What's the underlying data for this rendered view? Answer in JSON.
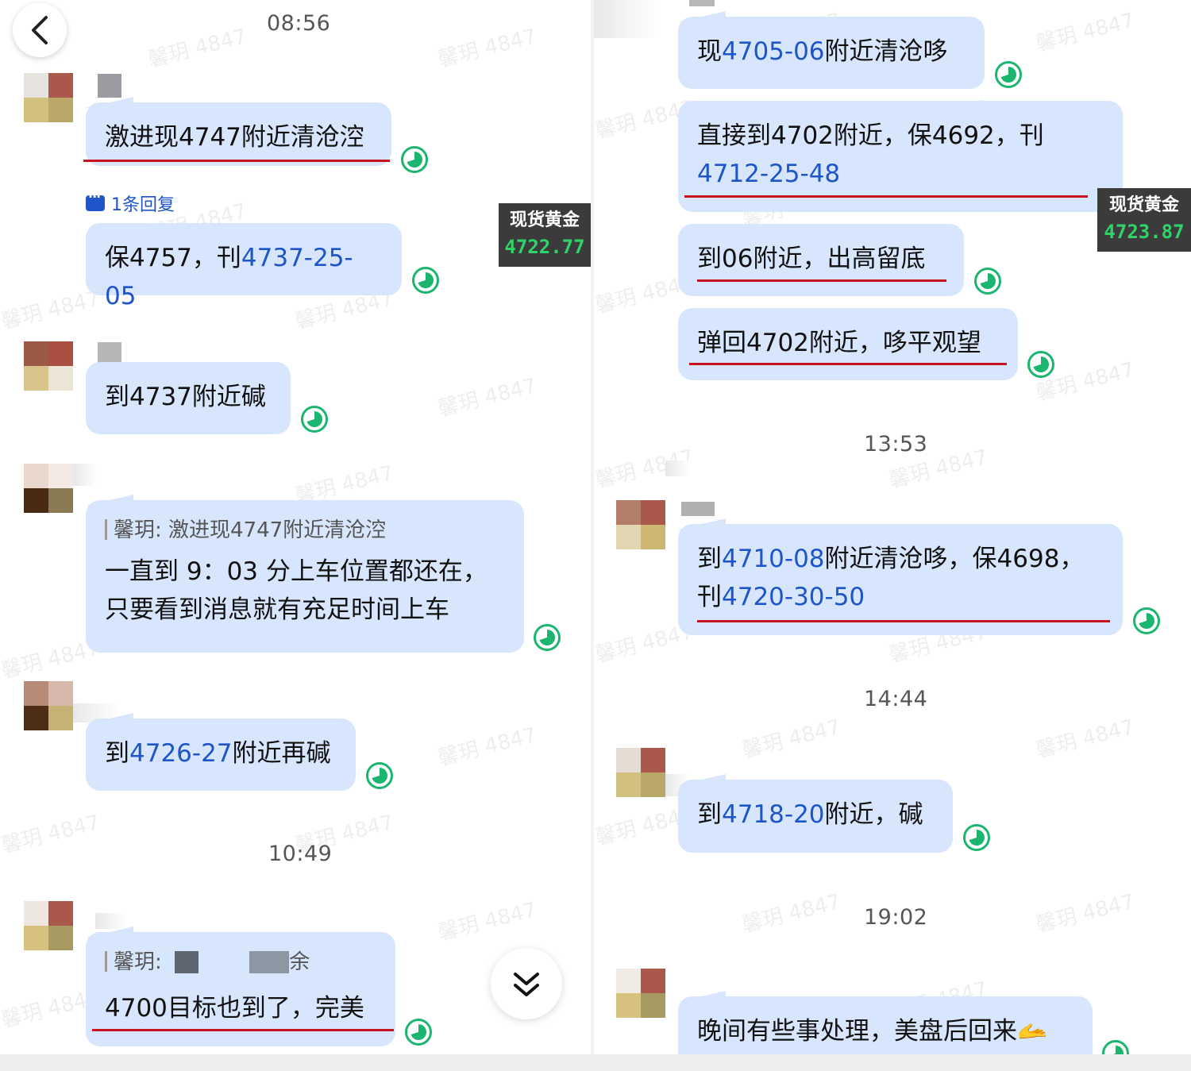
{
  "left": {
    "times": [
      "08:56",
      "10:49"
    ],
    "reply_count": "1条回复",
    "price": {
      "label": "现货黄金",
      "value": "4722.77"
    },
    "messages": {
      "m1": "激进现4747附近清沧涳",
      "m2_pre": "保4757，刊",
      "m2_num": "4737-25-05",
      "m3": "到4737附近碱",
      "m4_quote": "馨玥: 激进现4747附近清沧涳",
      "m4_line1": "一直到 9：03 分上车位置都还在，",
      "m4_line2": "只要看到消息就有充足时间上车",
      "m5_pre": "到",
      "m5_num": "4726-27",
      "m5_post": "附近再碱",
      "m6_quote_name": "馨玥:",
      "m6_quote_tail": "余",
      "m6_text": "4700目标也到了，完美"
    }
  },
  "right": {
    "times": [
      "13:53",
      "14:44",
      "19:02"
    ],
    "price": {
      "label": "现货黄金",
      "value": "4723.87"
    },
    "messages": {
      "r1_pre": "现",
      "r1_num": "4705-06",
      "r1_post": "附近清沧哆",
      "r2_line1": "直接到4702附近，保4692，刊",
      "r2_num": "4712-25-48",
      "r3": "到06附近，出高留底",
      "r4": "弹回4702附近，哆平观望",
      "r5_pre": "到",
      "r5_num1": "4710-08",
      "r5_mid": "附近清沧哆，保4698，",
      "r5_pre2": "刊",
      "r5_num2": "4720-30-50",
      "r6_pre": "到",
      "r6_num": "4718-20",
      "r6_post": "附近，碱",
      "r7": "晚间有些事处理，美盘后回来🫴"
    }
  },
  "watermark": "馨玥 4847",
  "icons": {
    "back": "back-arrow-icon",
    "scroll": "double-chevron-down-icon",
    "read": "read-status-icon"
  },
  "colors": {
    "bubble": "#d7e6fd",
    "number_link": "#1e55c8",
    "underline": "#c8121d",
    "read": "#1bb56f",
    "price_value": "#2fd36a"
  }
}
